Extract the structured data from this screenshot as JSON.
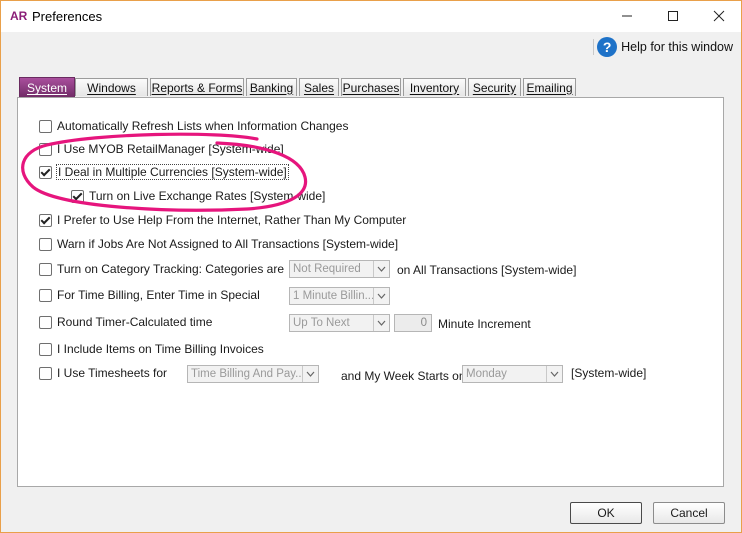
{
  "window": {
    "app_badge": "AR",
    "title": "Preferences"
  },
  "help": {
    "label": "Help for this window"
  },
  "tabs": [
    {
      "label": "System",
      "active": true
    },
    {
      "label": "Windows"
    },
    {
      "label": "Reports & Forms"
    },
    {
      "label": "Banking"
    },
    {
      "label": "Sales"
    },
    {
      "label": "Purchases"
    },
    {
      "label": "Inventory"
    },
    {
      "label": "Security"
    },
    {
      "label": "Emailing"
    }
  ],
  "options": {
    "auto_refresh": {
      "label": "Automatically Refresh Lists when Information Changes",
      "checked": false
    },
    "retail_manager": {
      "label": "I Use MYOB RetailManager [System-wide]",
      "checked": false
    },
    "multi_currency": {
      "label": "I Deal in Multiple Currencies [System-wide]",
      "checked": true
    },
    "live_rates": {
      "label": "Turn on Live Exchange Rates [System-wide]",
      "checked": true
    },
    "help_internet": {
      "label": "I Prefer to Use Help From the Internet, Rather Than My Computer",
      "checked": true
    },
    "warn_jobs": {
      "label": "Warn if Jobs Are Not Assigned to All Transactions [System-wide]",
      "checked": false
    },
    "category_tracking": {
      "label": "Turn on Category Tracking: Categories are",
      "checked": false,
      "select_value": "Not Required",
      "suffix": "on All Transactions [System-wide]"
    },
    "time_billing": {
      "label": "For Time Billing, Enter Time in Special",
      "checked": false,
      "select_value": "1 Minute Billin..."
    },
    "round_timer": {
      "label": "Round Timer-Calculated time",
      "checked": false,
      "select_value": "Up To Next",
      "spin_value": "0",
      "suffix": "Minute Increment"
    },
    "include_items": {
      "label": "I Include Items on Time Billing Invoices",
      "checked": false
    },
    "timesheets": {
      "label": "I Use Timesheets for",
      "checked": false,
      "select_value": "Time Billing And Pay...",
      "week_label": "and My Week Starts on",
      "week_value": "Monday",
      "suffix": "[System-wide]"
    }
  },
  "buttons": {
    "ok": "OK",
    "cancel": "Cancel"
  },
  "colors": {
    "accent_tab": "#8b3a80",
    "highlight_ring": "#e6157d",
    "help_icon": "#1e72c8",
    "window_border": "#e9a04a"
  }
}
